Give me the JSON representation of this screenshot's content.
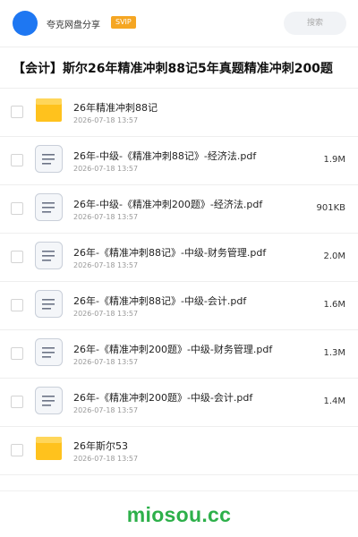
{
  "header": {
    "app_name": "夸克网盘分享",
    "badge": "SVIP",
    "search_placeholder": "搜索",
    "accent_color": "#1E77F2",
    "badge_color": "#F5A623"
  },
  "page_title": "【会计】斯尔26年精准冲刺88记5年真题精准冲刺200题",
  "files": [
    {
      "name": "26年精准冲刺88记",
      "date": "2026-07-18 13:57",
      "size": "",
      "type": "folder-icon"
    },
    {
      "name": "26年-中级-《精准冲刺88记》-经济法.pdf",
      "date": "2026-07-18 13:57",
      "size": "1.9M",
      "type": "document-icon"
    },
    {
      "name": "26年-中级-《精准冲刺200题》-经济法.pdf",
      "date": "2026-07-18 13:57",
      "size": "901KB",
      "type": "document-icon"
    },
    {
      "name": "26年-《精准冲刺88记》-中级-财务管理.pdf",
      "date": "2026-07-18 13:57",
      "size": "2.0M",
      "type": "document-icon"
    },
    {
      "name": "26年-《精准冲刺88记》-中级-会计.pdf",
      "date": "2026-07-18 13:57",
      "size": "1.6M",
      "type": "document-icon"
    },
    {
      "name": "26年-《精准冲刺200题》-中级-财务管理.pdf",
      "date": "2026-07-18 13:57",
      "size": "1.3M",
      "type": "document-icon"
    },
    {
      "name": "26年-《精准冲刺200题》-中级-会计.pdf",
      "date": "2026-07-18 13:57",
      "size": "1.4M",
      "type": "document-icon"
    },
    {
      "name": "26年斯尔53",
      "date": "2026-07-18 13:57",
      "size": "",
      "type": "folder-icon"
    }
  ],
  "watermark": "miosou.cc",
  "watermark_color": "#2DB04A"
}
